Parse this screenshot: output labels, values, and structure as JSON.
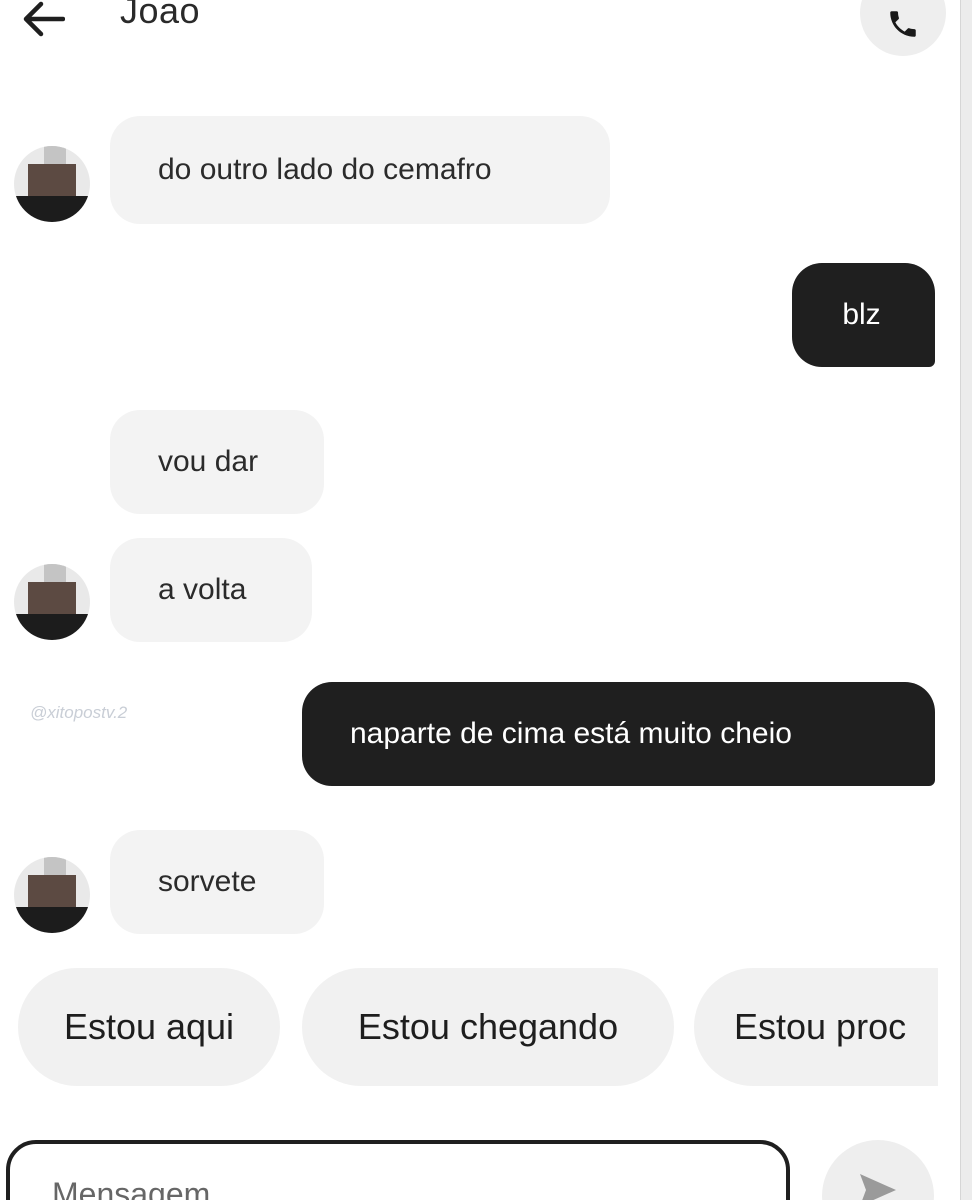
{
  "header": {
    "title": "Joao",
    "back_icon": "arrow-left-icon",
    "call_icon": "phone-icon"
  },
  "messages": [
    {
      "direction": "in",
      "text": "do outro lado do cemafro",
      "avatar": true
    },
    {
      "direction": "out",
      "text": "blz"
    },
    {
      "direction": "in",
      "text": "vou dar",
      "avatar": false
    },
    {
      "direction": "in",
      "text": "a volta",
      "avatar": true
    },
    {
      "direction": "out",
      "text": "naparte de cima está muito cheio"
    },
    {
      "direction": "in",
      "text": "sorvete",
      "avatar": true
    }
  ],
  "watermark": "@xitopostv.2",
  "quick_replies": [
    "Estou aqui",
    "Estou chegando",
    "Estou proc"
  ],
  "composer": {
    "placeholder": "Mensagem",
    "send_icon": "send-icon"
  },
  "colors": {
    "outgoing_bubble": "#1f1f1f",
    "incoming_bubble": "#f3f3f3",
    "chip": "#f1f1f1"
  }
}
